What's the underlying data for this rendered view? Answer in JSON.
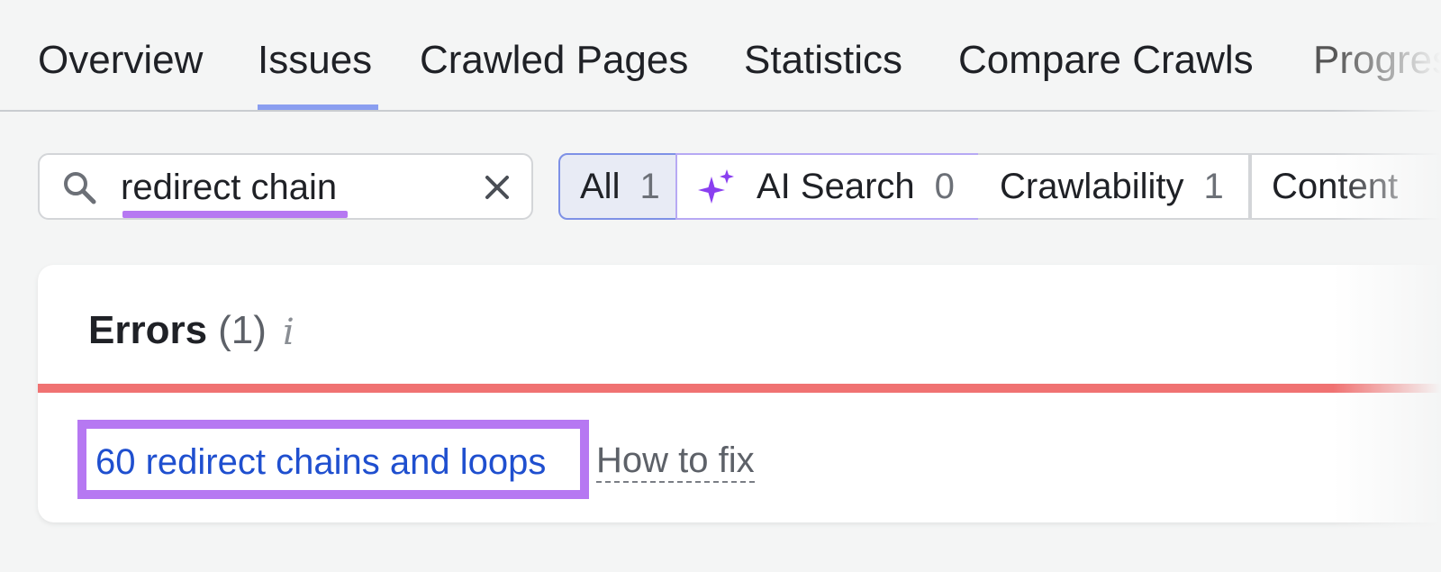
{
  "tabs": [
    {
      "label": "Overview",
      "active": false
    },
    {
      "label": "Issues",
      "active": true
    },
    {
      "label": "Crawled Pages",
      "active": false
    },
    {
      "label": "Statistics",
      "active": false
    },
    {
      "label": "Compare Crawls",
      "active": false
    },
    {
      "label": "Progress",
      "active": false
    }
  ],
  "search": {
    "value": "redirect chain",
    "search_icon": "search-icon",
    "clear_icon": "close-icon"
  },
  "filters": [
    {
      "label": "All",
      "count": "1",
      "selected": true
    },
    {
      "label": "AI Search",
      "count": "0",
      "icon": "sparkle-icon"
    },
    {
      "label": "Crawlability",
      "count": "1"
    },
    {
      "label": "Content",
      "count": ""
    }
  ],
  "errors": {
    "title": "Errors",
    "count": "(1)",
    "info_icon": "info-icon",
    "bar_color": "#f07272",
    "issue_link": "60 redirect chains and loops",
    "how_to_fix": "How to fix"
  },
  "colors": {
    "accent": "#8a9ef0",
    "highlight": "#b678f2",
    "link": "#1f4fcf"
  }
}
